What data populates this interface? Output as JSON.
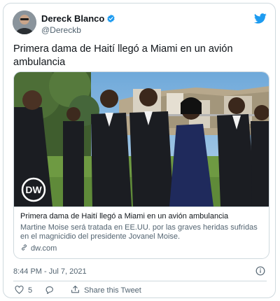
{
  "tweet": {
    "author_name": "Dereck Blanco",
    "author_handle": "@Dereckb",
    "text": "Primera dama de Haití llegó a Miami en un avión ambulancia",
    "timestamp": "8:44 PM - Jul 7, 2021",
    "likes": "5",
    "share_label": "Share this Tweet"
  },
  "card": {
    "image_watermark": "DW",
    "title": "Primera dama de Haití llegó a Miami en un avión ambulancia",
    "description": "Martine Moise será tratada en EE.UU. por las graves heridas sufridas en el magnicidio del presidente Jovanel Moise.",
    "domain": "dw.com"
  },
  "colors": {
    "twitter_blue": "#1d9bf0",
    "text_primary": "#0f1419",
    "text_secondary": "#536471",
    "border": "#cfd9de"
  },
  "icons": [
    "verified-badge-icon",
    "twitter-bird-icon",
    "link-icon",
    "info-icon",
    "heart-icon",
    "reply-icon",
    "share-icon"
  ]
}
